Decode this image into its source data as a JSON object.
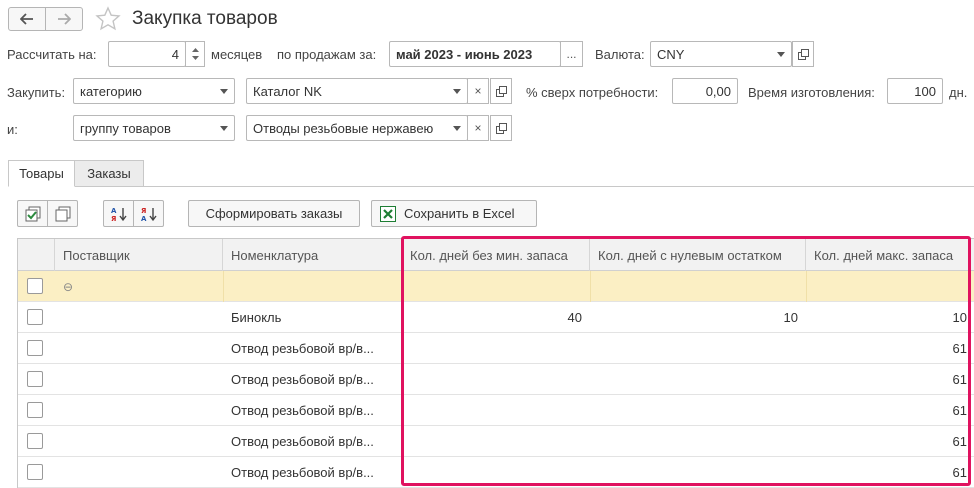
{
  "header": {
    "title": "Закупка товаров"
  },
  "params": {
    "calc_label": "Рассчитать на:",
    "calc_value": "4",
    "calc_unit": "месяцев",
    "sales_label": "по продажам за:",
    "sales_period": "май 2023 - июнь 2023",
    "sales_more": "...",
    "currency_label": "Валюта:",
    "currency_value": "CNY",
    "buy_label": "Закупить:",
    "buy_type": "категорию",
    "buy_catalog": "Каталог NK",
    "surplus_label": "% сверх потребности:",
    "surplus_value": "0,00",
    "mfg_label": "Время изготовления:",
    "mfg_value": "100",
    "mfg_unit": "дн.",
    "and_label": "и:",
    "and_type": "группу товаров",
    "and_value": "Отводы резьбовые нержавею",
    "clear_glyph": "×"
  },
  "tabs": [
    {
      "label": "Товары",
      "active": true
    },
    {
      "label": "Заказы",
      "active": false
    }
  ],
  "toolbar": {
    "form_orders": "Сформировать заказы",
    "save_excel": "Сохранить в Excel"
  },
  "table": {
    "columns": [
      "Поставщик",
      "Номенклатура",
      "Кол. дней без мин. запаса",
      "Кол. дней с нулевым остатком",
      "Кол. дней макс. запаса"
    ],
    "group_glyph": "⊖",
    "rows": [
      {
        "supplier": "",
        "item": "Бинокль",
        "days_no_min": "40",
        "days_zero": "10",
        "days_max": "10"
      },
      {
        "supplier": "",
        "item": "Отвод резьбовой вр/в...",
        "days_no_min": "",
        "days_zero": "",
        "days_max": "61"
      },
      {
        "supplier": "",
        "item": "Отвод резьбовой вр/в...",
        "days_no_min": "",
        "days_zero": "",
        "days_max": "61"
      },
      {
        "supplier": "",
        "item": "Отвод резьбовой вр/в...",
        "days_no_min": "",
        "days_zero": "",
        "days_max": "61"
      },
      {
        "supplier": "",
        "item": "Отвод резьбовой вр/в...",
        "days_no_min": "",
        "days_zero": "",
        "days_max": "61"
      },
      {
        "supplier": "",
        "item": "Отвод резьбовой вр/в...",
        "days_no_min": "",
        "days_zero": "",
        "days_max": "61"
      }
    ]
  },
  "colors": {
    "highlight": "#e0125f",
    "group_row": "#fbefc4",
    "excel_green": "#1e7e34"
  }
}
